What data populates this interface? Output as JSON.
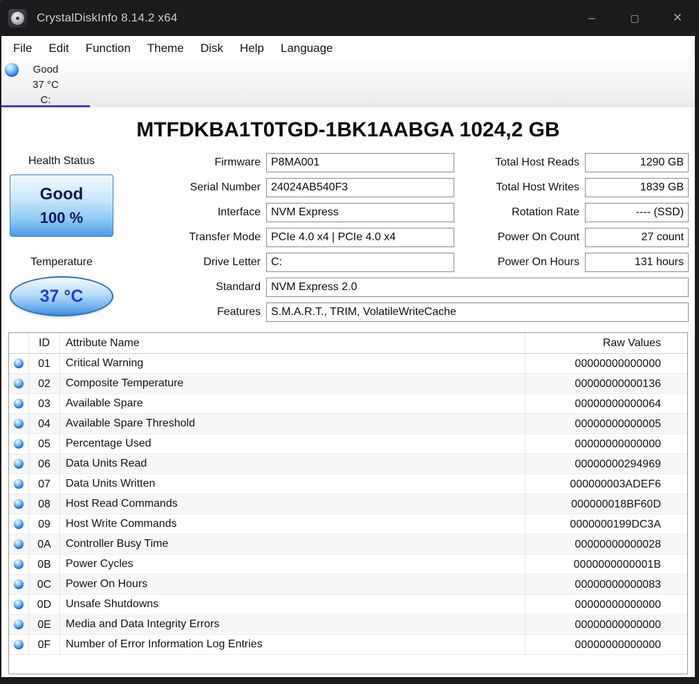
{
  "window": {
    "title": "CrystalDiskInfo 8.14.2 x64",
    "controls": {
      "minimize": "–",
      "maximize": "▢",
      "close": "✕"
    }
  },
  "menu": {
    "items": [
      "File",
      "Edit",
      "Function",
      "Theme",
      "Disk",
      "Help",
      "Language"
    ]
  },
  "drive_tab": {
    "status": "Good",
    "temperature": "37 °C",
    "letter": "C:"
  },
  "drive": {
    "title": "MTFDKBA1T0TGD-1BK1AABGA 1024,2 GB",
    "health": {
      "label": "Health Status",
      "status": "Good",
      "percent": "100 %"
    },
    "temperature": {
      "label": "Temperature",
      "value": "37 °C"
    },
    "info_fields": [
      {
        "label": "Firmware",
        "value": "P8MA001"
      },
      {
        "label": "Serial Number",
        "value": "24024AB540F3"
      },
      {
        "label": "Interface",
        "value": "NVM Express"
      },
      {
        "label": "Transfer Mode",
        "value": "PCIe 4.0 x4 | PCIe 4.0 x4"
      },
      {
        "label": "Drive Letter",
        "value": "C:"
      },
      {
        "label": "Standard",
        "value": "NVM Express 2.0"
      },
      {
        "label": "Features",
        "value": "S.M.A.R.T., TRIM, VolatileWriteCache"
      }
    ],
    "stats_fields": [
      {
        "label": "Total Host Reads",
        "value": "1290 GB"
      },
      {
        "label": "Total Host Writes",
        "value": "1839 GB"
      },
      {
        "label": "Rotation Rate",
        "value": "---- (SSD)"
      },
      {
        "label": "Power On Count",
        "value": "27 count"
      },
      {
        "label": "Power On Hours",
        "value": "131 hours"
      }
    ]
  },
  "smart_table": {
    "headers": {
      "id": "ID",
      "name": "Attribute Name",
      "raw": "Raw Values"
    },
    "rows": [
      {
        "id": "01",
        "name": "Critical Warning",
        "raw": "00000000000000"
      },
      {
        "id": "02",
        "name": "Composite Temperature",
        "raw": "00000000000136"
      },
      {
        "id": "03",
        "name": "Available Spare",
        "raw": "00000000000064"
      },
      {
        "id": "04",
        "name": "Available Spare Threshold",
        "raw": "00000000000005"
      },
      {
        "id": "05",
        "name": "Percentage Used",
        "raw": "00000000000000"
      },
      {
        "id": "06",
        "name": "Data Units Read",
        "raw": "00000000294969"
      },
      {
        "id": "07",
        "name": "Data Units Written",
        "raw": "000000003ADEF6"
      },
      {
        "id": "08",
        "name": "Host Read Commands",
        "raw": "000000018BF60D"
      },
      {
        "id": "09",
        "name": "Host Write Commands",
        "raw": "0000000199DC3A"
      },
      {
        "id": "0A",
        "name": "Controller Busy Time",
        "raw": "00000000000028"
      },
      {
        "id": "0B",
        "name": "Power Cycles",
        "raw": "0000000000001B"
      },
      {
        "id": "0C",
        "name": "Power On Hours",
        "raw": "00000000000083"
      },
      {
        "id": "0D",
        "name": "Unsafe Shutdowns",
        "raw": "00000000000000"
      },
      {
        "id": "0E",
        "name": "Media and Data Integrity Errors",
        "raw": "00000000000000"
      },
      {
        "id": "0F",
        "name": "Number of Error Information Log Entries",
        "raw": "00000000000000"
      }
    ]
  },
  "colors": {
    "titlebar_bg": "#1b1b1d",
    "accent_underline": "#4040c8",
    "status_good_orb": "#3e96f0",
    "health_text": "#0a1a5c",
    "temperature_text": "#1f3fd4"
  }
}
